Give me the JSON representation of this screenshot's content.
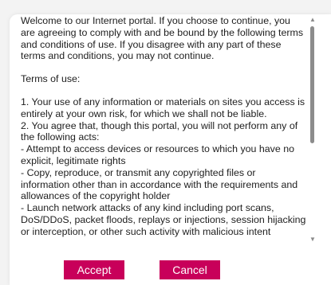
{
  "terms": {
    "intro": "Welcome to our Internet portal. If you choose to continue, you are agreeing to comply with and be bound by the following terms and conditions of use. If you disagree with any part of these terms and conditions, you may not continue.",
    "heading": "Terms of use:",
    "items": [
      "1. Your use of any information or materials on sites you access is entirely at your own risk, for which we shall not be liable.",
      "2. You agree that, though this portal, you will not perform any of the following acts:",
      "- Attempt to access devices or resources to which you have no explicit, legitimate rights",
      "- Copy, reproduce, or transmit any copyrighted files or information other than in accordance with the requirements and allowances of the copyright holder",
      "- Launch network attacks of any kind including port scans, DoS/DDoS, packet floods, replays or injections, session hijacking or interception, or other such activity with malicious intent"
    ]
  },
  "buttons": {
    "accept": "Accept",
    "cancel": "Cancel"
  },
  "colors": {
    "accent": "#c8005a",
    "text": "#1e1e1e",
    "scroll_thumb": "#8c8c8c"
  },
  "icons": {
    "scroll_up": "triangle-up",
    "scroll_down": "triangle-down"
  }
}
